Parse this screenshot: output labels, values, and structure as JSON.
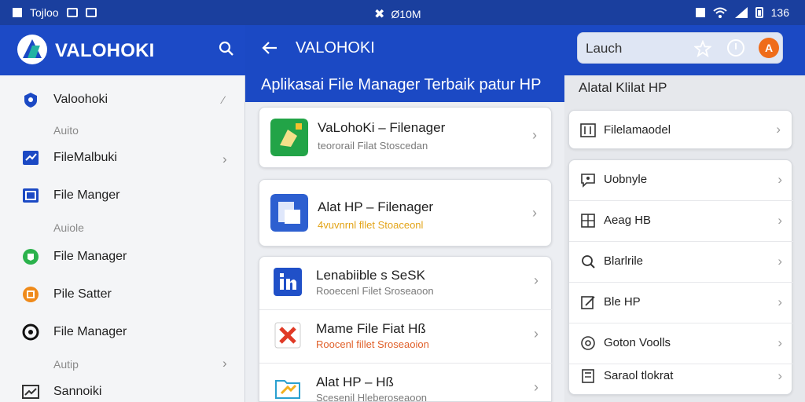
{
  "status_bar": {
    "left_label": "Tojloo",
    "center_label": "Ø10M",
    "right_label": "136"
  },
  "app_bar": {
    "brand": "VALOHOKI",
    "page_title": "VALOHOKI",
    "search_value": "Lauch",
    "avatar_letter": "A"
  },
  "colors": {
    "primary_blue": "#1b49c4",
    "status_blue": "#1a3f9e",
    "accent_orange": "#ef6c1a"
  },
  "sidebar": {
    "items": [
      {
        "label": "Valoohoki",
        "icon": "shield-icon"
      },
      {
        "label": "FileMalbuki",
        "icon": "file-icon"
      },
      {
        "label": "File Manger",
        "icon": "folder-icon"
      },
      {
        "label": "File Manager",
        "icon": "green-badge-icon"
      },
      {
        "label": "Pile Satter",
        "icon": "orange-badge-icon"
      },
      {
        "label": "File Manager",
        "icon": "ring-icon"
      },
      {
        "label": "Sannoiki",
        "icon": "chart-icon"
      }
    ],
    "sections": [
      "Auito",
      "Auiole",
      "Autip"
    ]
  },
  "main": {
    "header": "Aplikasai File Manager Terbaik patur HP",
    "cards": [
      {
        "title": "VaLohoKi – Filenager",
        "subtitle": "teororail Filat Stoscedan",
        "icon": "green-file-icon"
      },
      {
        "title": "Alat HP – Filenager",
        "subtitle": "4vuvnrnl fllet Stoaceonl",
        "icon": "blue-file-icon"
      }
    ],
    "group": [
      {
        "title": "Lenabiible s SeSK",
        "subtitle": "Rooecenl Filet Sroseaoon",
        "icon": "linkedin-icon"
      },
      {
        "title": "Mame File Fiat Hß",
        "subtitle": "Roocenl fillet Sroseaoion",
        "icon": "close-box-icon"
      },
      {
        "title": "Alat HP – Hß",
        "subtitle": "Scesenil Hleberoseaoon",
        "icon": "folder-icon"
      }
    ]
  },
  "right_panel": {
    "title": "Alatal Klilat HP",
    "top_item": {
      "label": "Filelamaodel",
      "icon": "sliders-icon"
    },
    "items": [
      {
        "label": "Uobnyle",
        "icon": "chat-icon"
      },
      {
        "label": "Aeag HB",
        "icon": "grid-icon"
      },
      {
        "label": "Blarlrile",
        "icon": "search-icon"
      },
      {
        "label": "Ble HP",
        "icon": "edit-icon"
      },
      {
        "label": "Goton Voolls",
        "icon": "at-icon"
      },
      {
        "label": "Saraol tlokrat",
        "icon": "calculator-icon"
      }
    ]
  }
}
